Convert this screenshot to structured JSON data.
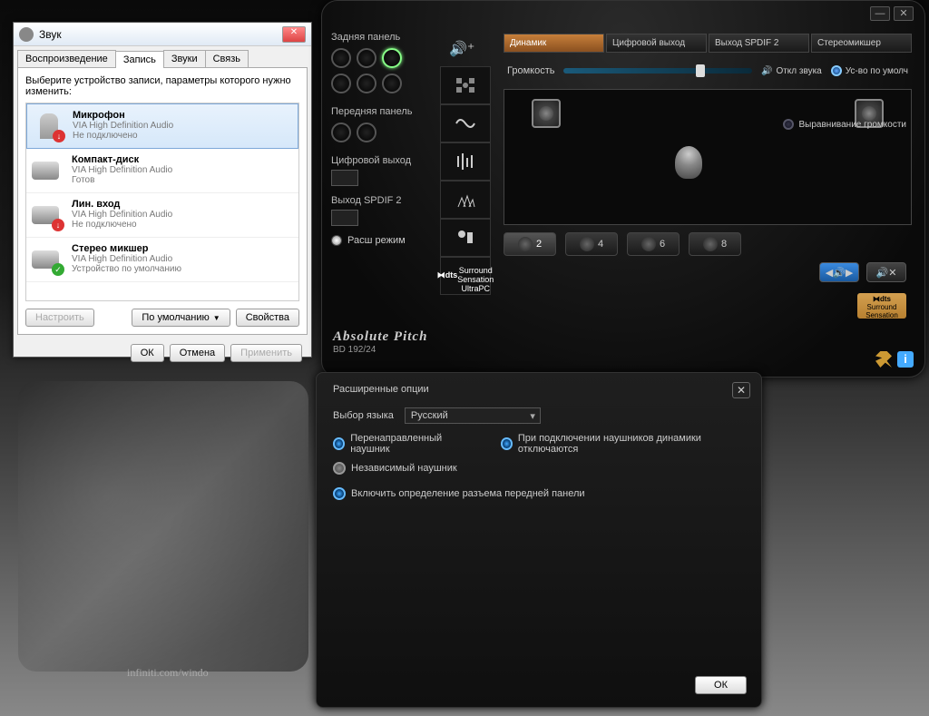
{
  "sound_dialog": {
    "title": "Звук",
    "tabs": [
      "Воспроизведение",
      "Запись",
      "Звуки",
      "Связь"
    ],
    "active_tab": 1,
    "instruction": "Выберите устройство записи, параметры которого нужно изменить:",
    "devices": [
      {
        "name": "Микрофон",
        "sub": "VIA High Definition Audio",
        "status": "Не подключено",
        "badge": "red",
        "selected": true,
        "icon": "mic"
      },
      {
        "name": "Компакт-диск",
        "sub": "VIA High Definition Audio",
        "status": "Готов",
        "badge": "none",
        "selected": false,
        "icon": "plug"
      },
      {
        "name": "Лин. вход",
        "sub": "VIA High Definition Audio",
        "status": "Не подключено",
        "badge": "red",
        "selected": false,
        "icon": "plug"
      },
      {
        "name": "Стерео микшер",
        "sub": "VIA High Definition Audio",
        "status": "Устройство по умолчанию",
        "badge": "green",
        "selected": false,
        "icon": "plug"
      }
    ],
    "btn_configure": "Настроить",
    "btn_default": "По умолчанию",
    "btn_properties": "Свойства",
    "btn_ok": "ОК",
    "btn_cancel": "Отмена",
    "btn_apply": "Применить"
  },
  "audio_panel": {
    "rear_panel": "Задняя панель",
    "front_panel": "Передняя панель",
    "digital_out": "Цифровой выход",
    "spdif2": "Выход SPDIF 2",
    "adv_mode": "Расш режим",
    "brand_line1": "Absolute Pitch",
    "brand_line2": "BD 192/24",
    "top_tabs": [
      {
        "label": "Динамик",
        "active": true
      },
      {
        "label": "Цифровой выход",
        "active": false
      },
      {
        "label": "Выход SPDIF 2",
        "active": false
      },
      {
        "label": "Стереомикшер",
        "active": false
      }
    ],
    "volume_label": "Громкость",
    "mute_label": "Откл звука",
    "default_label": "Ус-во по умолч",
    "normalize": "Выравнивание громкости",
    "dts_text": "dts Surround Sensation UltraPC",
    "dts_badge": "dts Surround Sensation",
    "channels": [
      "2",
      "4",
      "6",
      "8"
    ],
    "active_channel": 0
  },
  "adv_dialog": {
    "title": "Расширенные опции",
    "lang_label": "Выбор языка",
    "lang_value": "Русский",
    "opt_redirect": "Перенаправленный наушник",
    "opt_independent": "Независимый наушник",
    "opt_mute_spk": "При подключении наушников динамики отключаются",
    "opt_detect": "Включить определение разъема передней панели",
    "btn_ok": "ОК"
  },
  "wallpaper": {
    "text": "infiniti.com/windo"
  }
}
